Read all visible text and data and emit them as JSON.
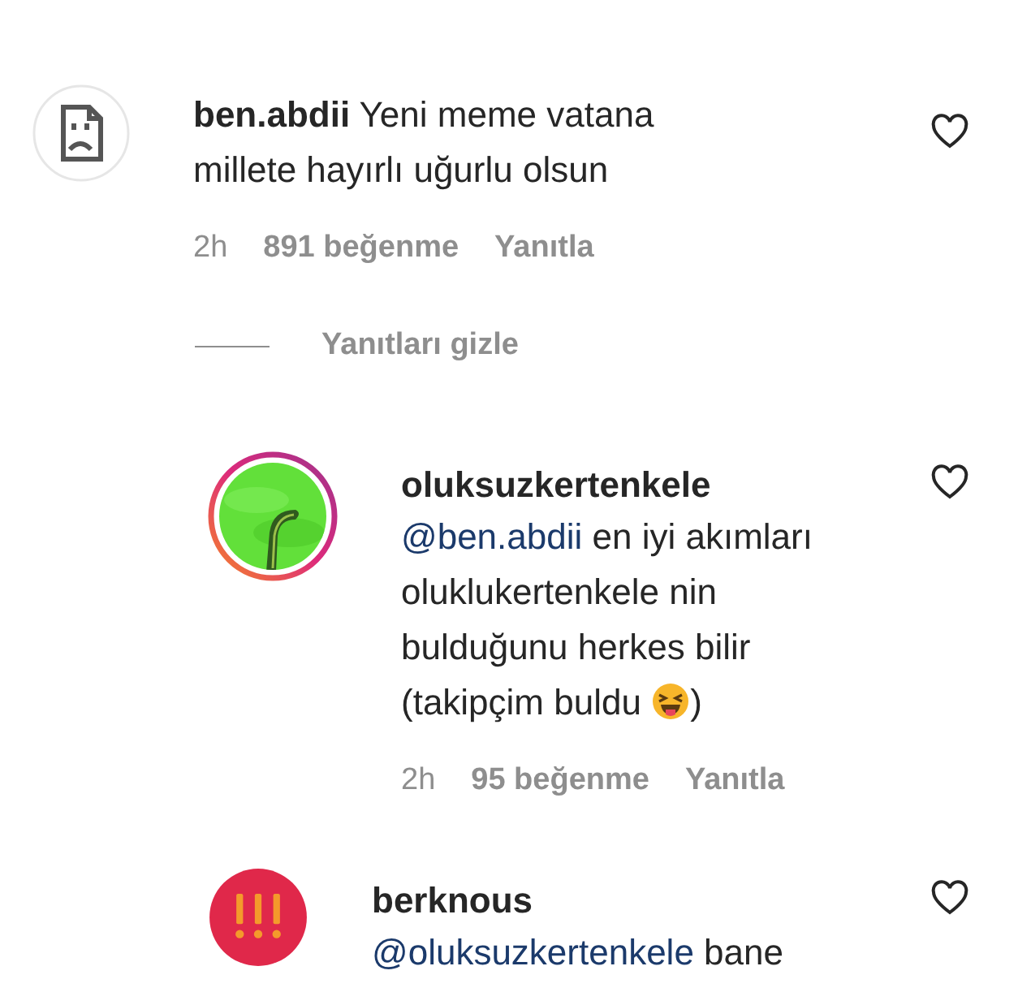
{
  "comment": {
    "avatar": {
      "kind": "broken"
    },
    "username": "ben.abdii",
    "text": "Yeni meme vatana millete hayırlı uğurlu olsun",
    "liked": false,
    "time": "2h",
    "likes": "891 beğenme",
    "reply_label": "Yanıtla"
  },
  "replies_toggle": "Yanıtları gizle",
  "replies": [
    {
      "avatar": {
        "kind": "story_photo"
      },
      "username": "oluksuzkertenkele",
      "mention": "@ben.abdii",
      "text": "en iyi akımları oluklukertenkele nin bulduğunu herkes bilir (takipçim buldu",
      "emoji": true,
      "text_end": ")",
      "liked": false,
      "time": "2h",
      "likes": "95 beğenme",
      "reply_label": "Yanıtla"
    },
    {
      "avatar": {
        "kind": "warning"
      },
      "username": "berknous",
      "mention": "@oluksuzkertenkele",
      "text": "bane",
      "liked": false
    }
  ]
}
